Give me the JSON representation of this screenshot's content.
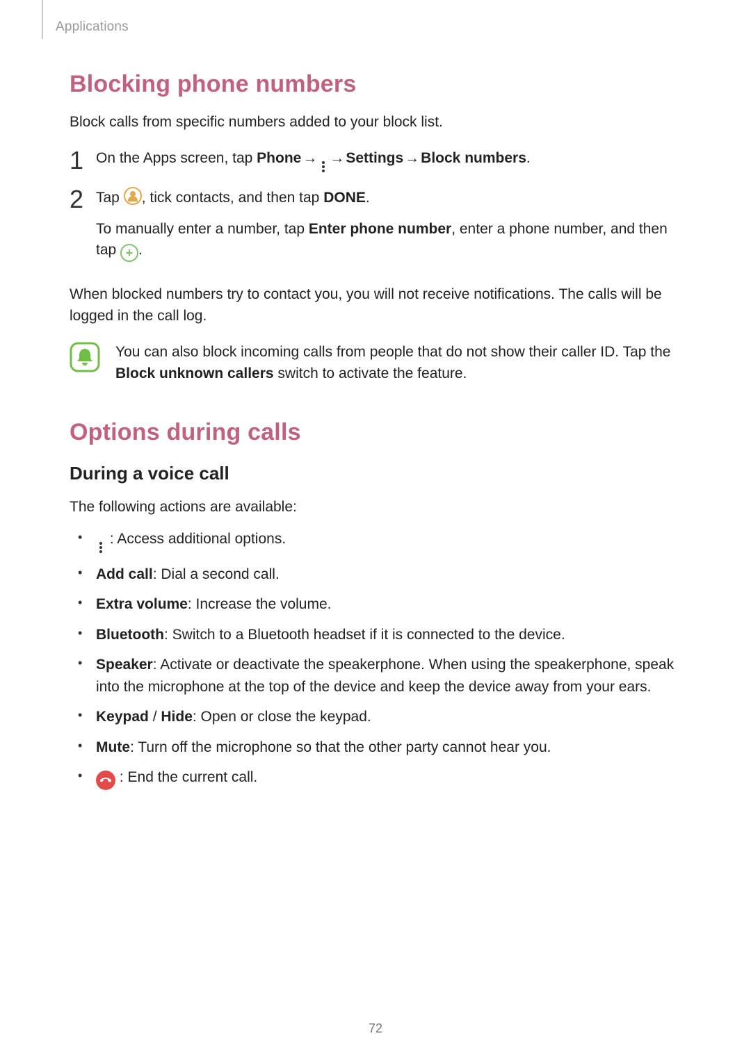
{
  "breadcrumb": "Applications",
  "section1": {
    "title": "Blocking phone numbers",
    "intro": "Block calls from specific numbers added to your block list.",
    "step1": {
      "pre": "On the Apps screen, tap ",
      "phone": "Phone",
      "arrow": " → ",
      "settings": "Settings",
      "block": "Block numbers",
      "end": "."
    },
    "step2": {
      "line1_pre": "Tap ",
      "line1_mid": ", tick contacts, and then tap ",
      "line1_done": "DONE",
      "line1_end": ".",
      "line2_pre": "To manually enter a number, tap ",
      "line2_bold": "Enter phone number",
      "line2_mid": ", enter a phone number, and then tap ",
      "line2_end": "."
    },
    "after": "When blocked numbers try to contact you, you will not receive notifications. The calls will be logged in the call log.",
    "note_pre": "You can also block incoming calls from people that do not show their caller ID. Tap the ",
    "note_bold": "Block unknown callers",
    "note_post": " switch to activate the feature."
  },
  "section2": {
    "title": "Options during calls",
    "sub": "During a voice call",
    "intro": "The following actions are available:",
    "items": {
      "more": " : Access additional options.",
      "addcall_b": "Add call",
      "addcall_t": ": Dial a second call.",
      "extra_b": "Extra volume",
      "extra_t": ": Increase the volume.",
      "bt_b": "Bluetooth",
      "bt_t": ": Switch to a Bluetooth headset if it is connected to the device.",
      "spk_b": "Speaker",
      "spk_t": ": Activate or deactivate the speakerphone. When using the speakerphone, speak into the microphone at the top of the device and keep the device away from your ears.",
      "key_b1": "Keypad",
      "key_sep": " / ",
      "key_b2": "Hide",
      "key_t": ": Open or close the keypad.",
      "mute_b": "Mute",
      "mute_t": ": Turn off the microphone so that the other party cannot hear you.",
      "end_t": " : End the current call."
    }
  },
  "page_number": "72"
}
